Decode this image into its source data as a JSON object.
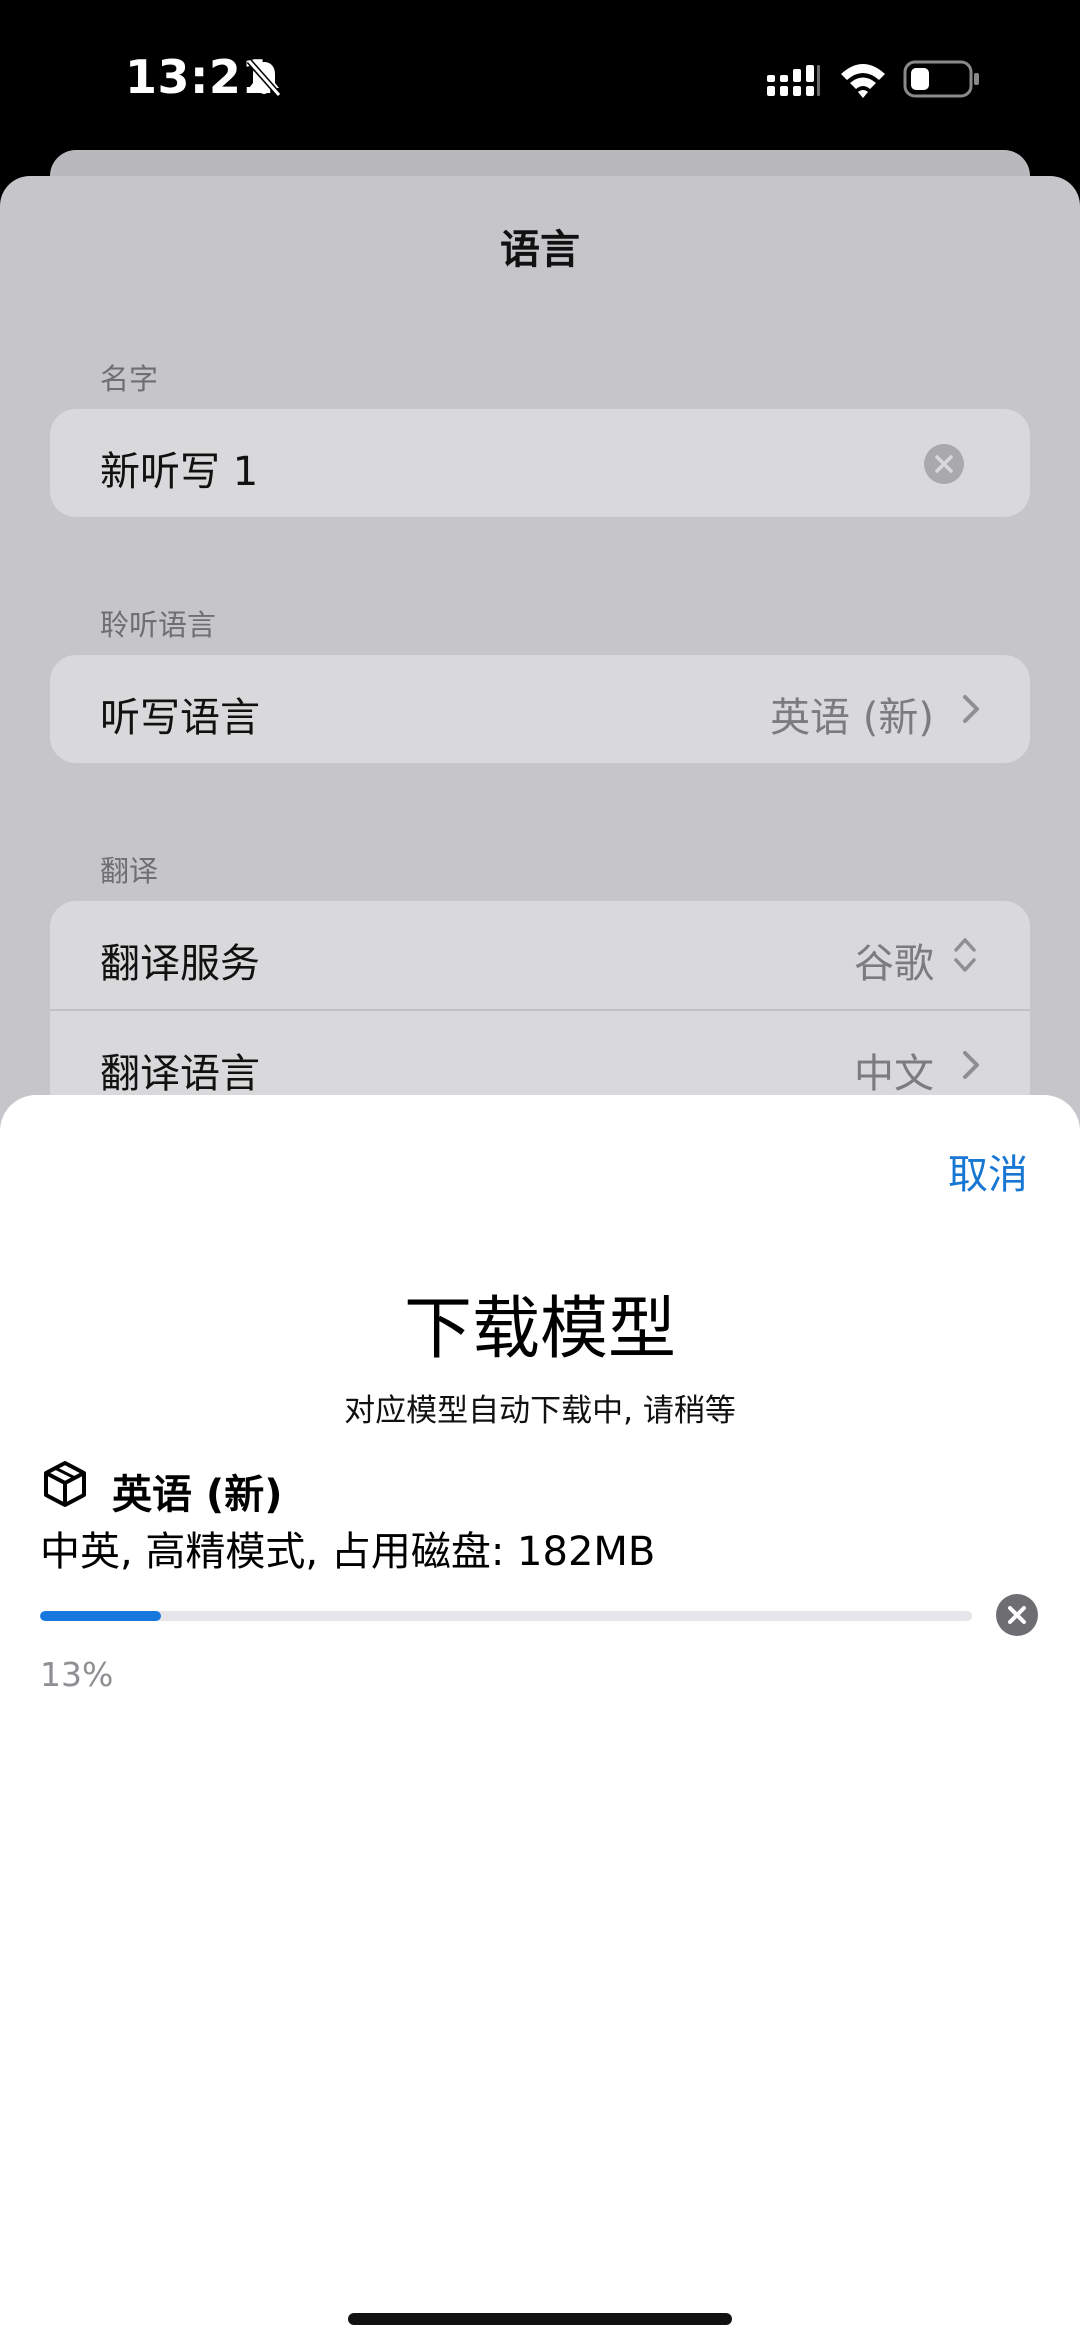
{
  "status_bar": {
    "time": "13:21"
  },
  "sheet": {
    "title": "语言",
    "name_section": {
      "label": "名字",
      "value": "新听写 1"
    },
    "listen_section": {
      "label": "聆听语言",
      "rows": [
        {
          "label": "听写语言",
          "value": "英语 (新)"
        }
      ]
    },
    "translate_section": {
      "label": "翻译",
      "rows": [
        {
          "label": "翻译服务",
          "value": "谷歌"
        },
        {
          "label": "翻译语言",
          "value": "中文"
        }
      ]
    }
  },
  "modal": {
    "cancel_label": "取消",
    "title": "下载模型",
    "subtitle": "对应模型自动下载中, 请稍等",
    "model": {
      "name": "英语 (新)",
      "description": "中英, 高精模式, 占用磁盘: 182MB",
      "progress_percent": 13,
      "progress_text": "13%"
    }
  },
  "colors": {
    "accent": "#1877d2",
    "progress": "#1878e0",
    "sheet_background": "#c6c6ca",
    "row_background": "#d9d9dc"
  }
}
